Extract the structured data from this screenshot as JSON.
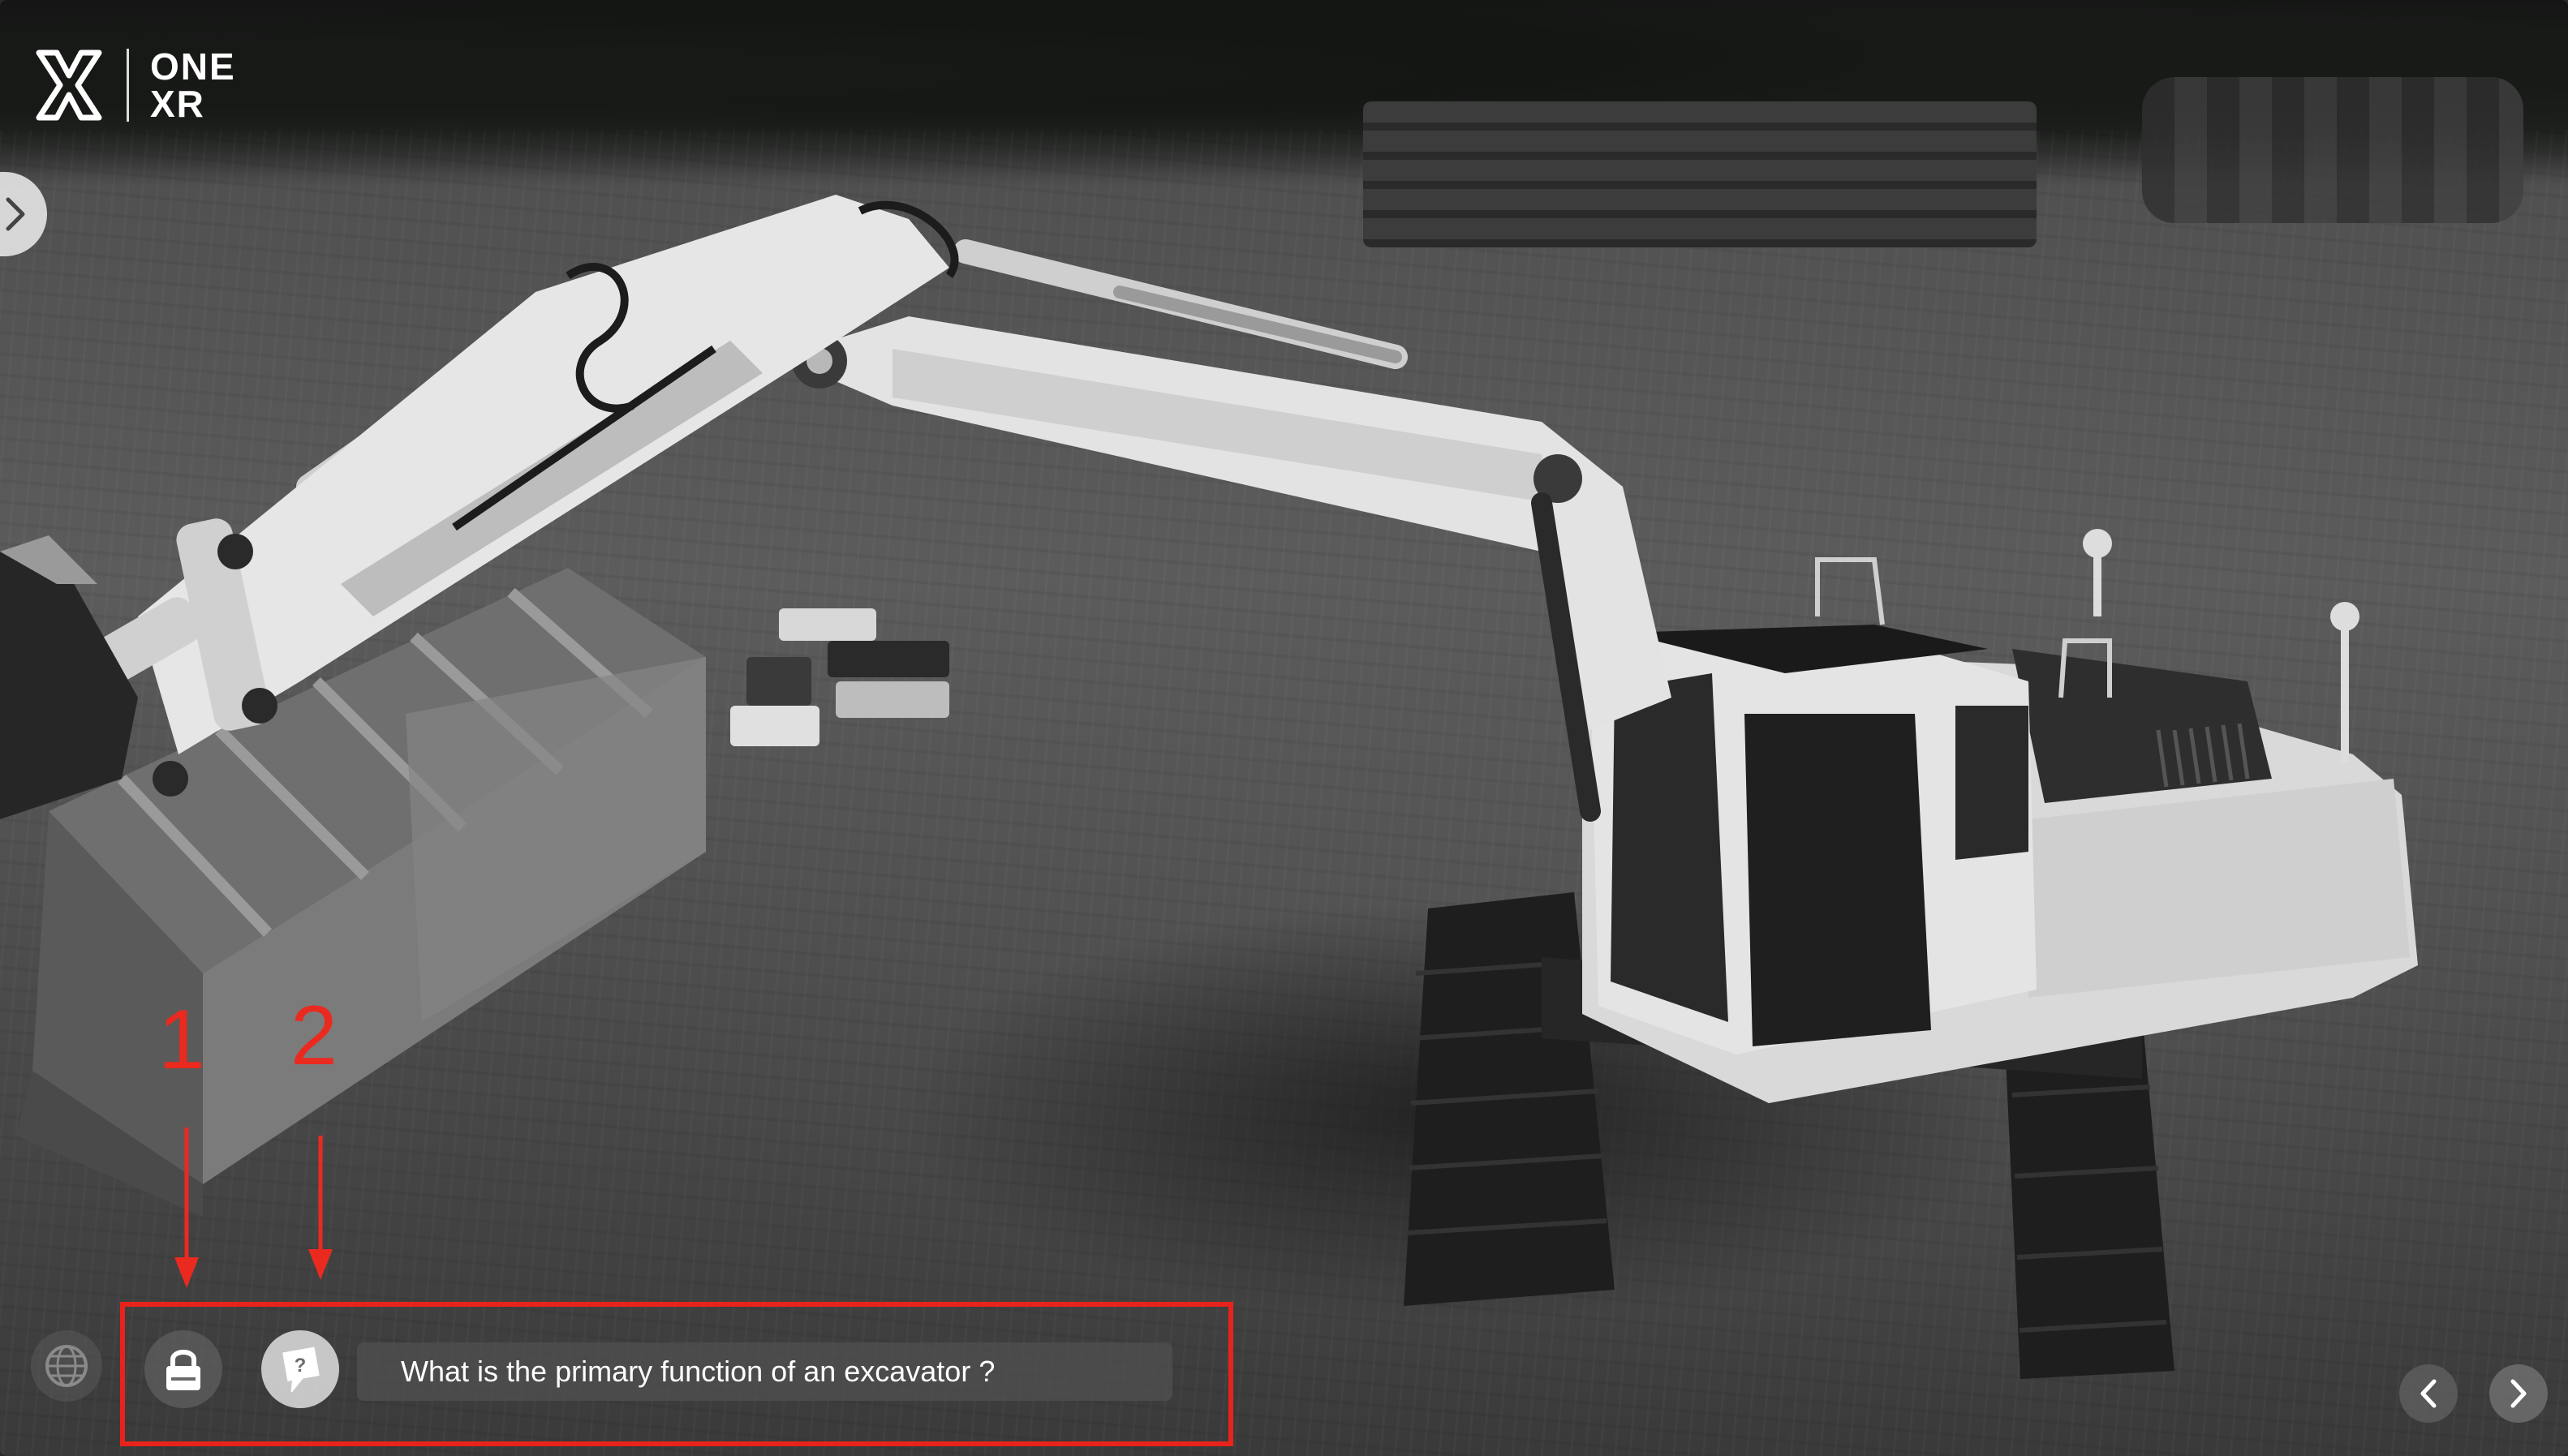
{
  "app": {
    "logo_text_line1": "ONE",
    "logo_text_line2": "XR",
    "logo_icon": "onexr-logo-icon"
  },
  "side_panel": {
    "toggle_icon": "chevron-right-icon"
  },
  "bottom_bar": {
    "globe_icon": "globe-icon",
    "lock_icon": "lock-icon",
    "help_icon": "question-bubble-icon",
    "question_text": "What is the primary function of an excavator ?"
  },
  "annotations": {
    "label_1": "1",
    "label_2": "2",
    "highlight_color": "#e8231b"
  },
  "navigation": {
    "prev_icon": "chevron-left-icon",
    "next_icon": "chevron-right-icon"
  },
  "colors": {
    "accent_red": "#e8231b",
    "text_white": "#ffffff"
  }
}
